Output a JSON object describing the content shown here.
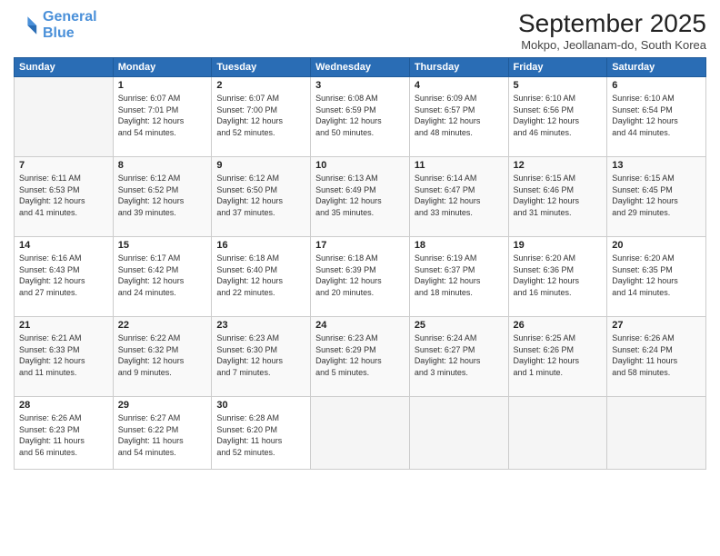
{
  "logo": {
    "line1": "General",
    "line2": "Blue"
  },
  "title": "September 2025",
  "location": "Mokpo, Jeollanam-do, South Korea",
  "headers": [
    "Sunday",
    "Monday",
    "Tuesday",
    "Wednesday",
    "Thursday",
    "Friday",
    "Saturday"
  ],
  "weeks": [
    [
      {
        "day": "",
        "info": ""
      },
      {
        "day": "1",
        "info": "Sunrise: 6:07 AM\nSunset: 7:01 PM\nDaylight: 12 hours\nand 54 minutes."
      },
      {
        "day": "2",
        "info": "Sunrise: 6:07 AM\nSunset: 7:00 PM\nDaylight: 12 hours\nand 52 minutes."
      },
      {
        "day": "3",
        "info": "Sunrise: 6:08 AM\nSunset: 6:59 PM\nDaylight: 12 hours\nand 50 minutes."
      },
      {
        "day": "4",
        "info": "Sunrise: 6:09 AM\nSunset: 6:57 PM\nDaylight: 12 hours\nand 48 minutes."
      },
      {
        "day": "5",
        "info": "Sunrise: 6:10 AM\nSunset: 6:56 PM\nDaylight: 12 hours\nand 46 minutes."
      },
      {
        "day": "6",
        "info": "Sunrise: 6:10 AM\nSunset: 6:54 PM\nDaylight: 12 hours\nand 44 minutes."
      }
    ],
    [
      {
        "day": "7",
        "info": "Sunrise: 6:11 AM\nSunset: 6:53 PM\nDaylight: 12 hours\nand 41 minutes."
      },
      {
        "day": "8",
        "info": "Sunrise: 6:12 AM\nSunset: 6:52 PM\nDaylight: 12 hours\nand 39 minutes."
      },
      {
        "day": "9",
        "info": "Sunrise: 6:12 AM\nSunset: 6:50 PM\nDaylight: 12 hours\nand 37 minutes."
      },
      {
        "day": "10",
        "info": "Sunrise: 6:13 AM\nSunset: 6:49 PM\nDaylight: 12 hours\nand 35 minutes."
      },
      {
        "day": "11",
        "info": "Sunrise: 6:14 AM\nSunset: 6:47 PM\nDaylight: 12 hours\nand 33 minutes."
      },
      {
        "day": "12",
        "info": "Sunrise: 6:15 AM\nSunset: 6:46 PM\nDaylight: 12 hours\nand 31 minutes."
      },
      {
        "day": "13",
        "info": "Sunrise: 6:15 AM\nSunset: 6:45 PM\nDaylight: 12 hours\nand 29 minutes."
      }
    ],
    [
      {
        "day": "14",
        "info": "Sunrise: 6:16 AM\nSunset: 6:43 PM\nDaylight: 12 hours\nand 27 minutes."
      },
      {
        "day": "15",
        "info": "Sunrise: 6:17 AM\nSunset: 6:42 PM\nDaylight: 12 hours\nand 24 minutes."
      },
      {
        "day": "16",
        "info": "Sunrise: 6:18 AM\nSunset: 6:40 PM\nDaylight: 12 hours\nand 22 minutes."
      },
      {
        "day": "17",
        "info": "Sunrise: 6:18 AM\nSunset: 6:39 PM\nDaylight: 12 hours\nand 20 minutes."
      },
      {
        "day": "18",
        "info": "Sunrise: 6:19 AM\nSunset: 6:37 PM\nDaylight: 12 hours\nand 18 minutes."
      },
      {
        "day": "19",
        "info": "Sunrise: 6:20 AM\nSunset: 6:36 PM\nDaylight: 12 hours\nand 16 minutes."
      },
      {
        "day": "20",
        "info": "Sunrise: 6:20 AM\nSunset: 6:35 PM\nDaylight: 12 hours\nand 14 minutes."
      }
    ],
    [
      {
        "day": "21",
        "info": "Sunrise: 6:21 AM\nSunset: 6:33 PM\nDaylight: 12 hours\nand 11 minutes."
      },
      {
        "day": "22",
        "info": "Sunrise: 6:22 AM\nSunset: 6:32 PM\nDaylight: 12 hours\nand 9 minutes."
      },
      {
        "day": "23",
        "info": "Sunrise: 6:23 AM\nSunset: 6:30 PM\nDaylight: 12 hours\nand 7 minutes."
      },
      {
        "day": "24",
        "info": "Sunrise: 6:23 AM\nSunset: 6:29 PM\nDaylight: 12 hours\nand 5 minutes."
      },
      {
        "day": "25",
        "info": "Sunrise: 6:24 AM\nSunset: 6:27 PM\nDaylight: 12 hours\nand 3 minutes."
      },
      {
        "day": "26",
        "info": "Sunrise: 6:25 AM\nSunset: 6:26 PM\nDaylight: 12 hours\nand 1 minute."
      },
      {
        "day": "27",
        "info": "Sunrise: 6:26 AM\nSunset: 6:24 PM\nDaylight: 11 hours\nand 58 minutes."
      }
    ],
    [
      {
        "day": "28",
        "info": "Sunrise: 6:26 AM\nSunset: 6:23 PM\nDaylight: 11 hours\nand 56 minutes."
      },
      {
        "day": "29",
        "info": "Sunrise: 6:27 AM\nSunset: 6:22 PM\nDaylight: 11 hours\nand 54 minutes."
      },
      {
        "day": "30",
        "info": "Sunrise: 6:28 AM\nSunset: 6:20 PM\nDaylight: 11 hours\nand 52 minutes."
      },
      {
        "day": "",
        "info": ""
      },
      {
        "day": "",
        "info": ""
      },
      {
        "day": "",
        "info": ""
      },
      {
        "day": "",
        "info": ""
      }
    ]
  ]
}
